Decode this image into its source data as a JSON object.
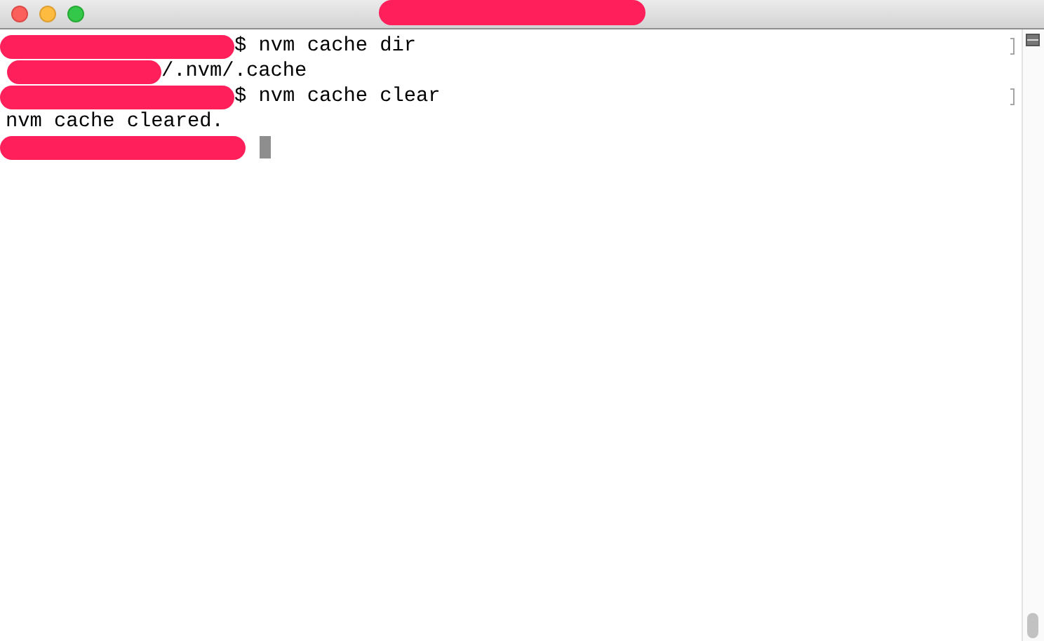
{
  "window": {
    "title_redacted": true
  },
  "lines": [
    {
      "kind": "command",
      "redacted_prefix": true,
      "text": "$ nvm cache dir",
      "marked": true,
      "cursor": false
    },
    {
      "kind": "output",
      "redacted_prefix": true,
      "text": "/.nvm/.cache",
      "marked": false,
      "cursor": false
    },
    {
      "kind": "command",
      "redacted_prefix": true,
      "text": "$ nvm cache clear",
      "marked": true,
      "cursor": false
    },
    {
      "kind": "output",
      "redacted_prefix": false,
      "text": "nvm cache cleared.",
      "marked": false,
      "cursor": false
    },
    {
      "kind": "prompt",
      "redacted_prefix": true,
      "marked": false,
      "cursor": true
    }
  ]
}
